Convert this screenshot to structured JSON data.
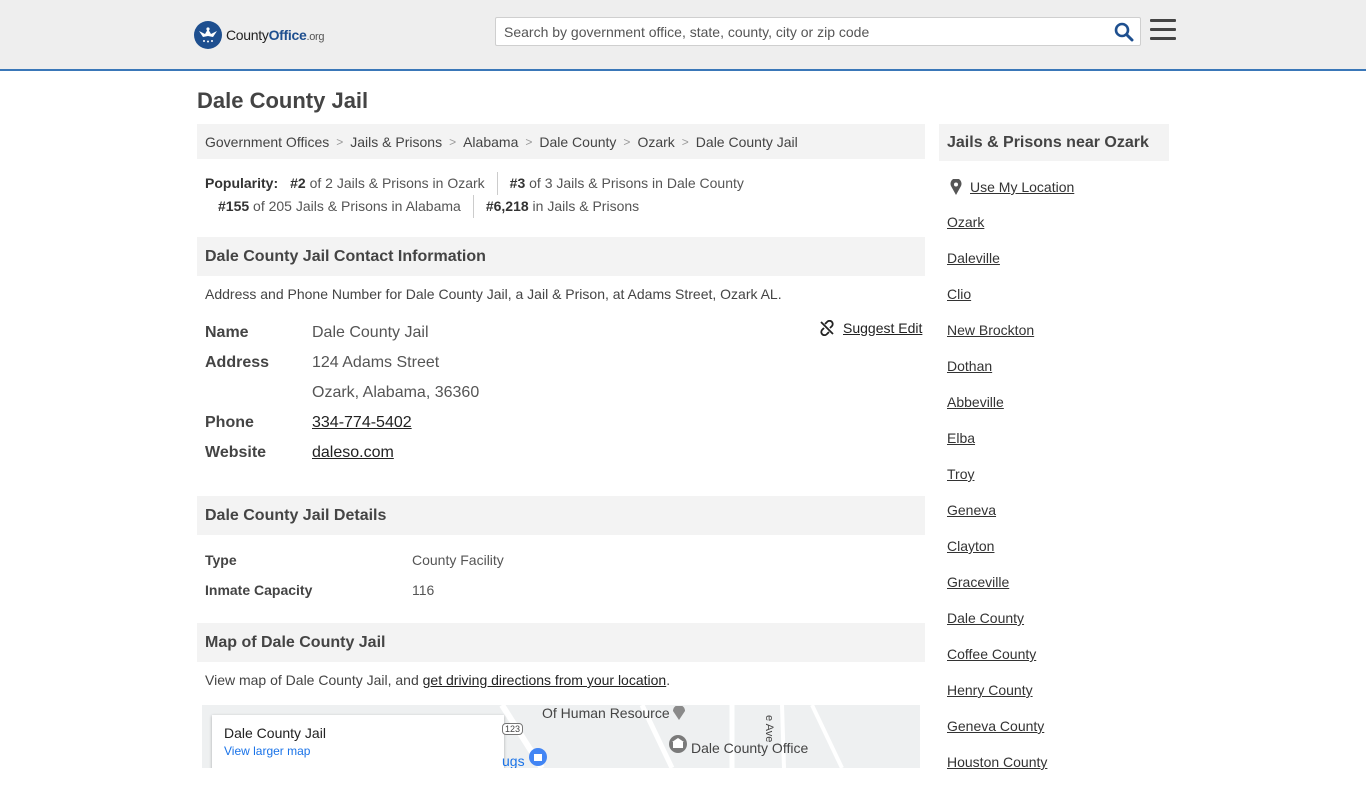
{
  "header": {
    "logo_county": "County",
    "logo_office": "Office",
    "logo_org": ".org",
    "search_placeholder": "Search by government office, state, county, city or zip code"
  },
  "page": {
    "title": "Dale County Jail"
  },
  "breadcrumb": [
    "Government Offices",
    "Jails & Prisons",
    "Alabama",
    "Dale County",
    "Ozark",
    "Dale County Jail"
  ],
  "popularity": {
    "label": "Popularity:",
    "items": [
      {
        "rank": "#2",
        "text": " of 2 Jails & Prisons in Ozark"
      },
      {
        "rank": "#3",
        "text": " of 3 Jails & Prisons in Dale County"
      },
      {
        "rank": "#155",
        "text": " of 205 Jails & Prisons in Alabama"
      },
      {
        "rank": "#6,218",
        "text": " in Jails & Prisons"
      }
    ]
  },
  "contact": {
    "heading": "Dale County Jail Contact Information",
    "description": "Address and Phone Number for Dale County Jail, a Jail & Prison, at Adams Street, Ozark AL.",
    "suggest_edit": "Suggest Edit",
    "name_label": "Name",
    "name": "Dale County Jail",
    "address_label": "Address",
    "address_line1": "124 Adams Street",
    "address_line2": "Ozark, Alabama, 36360",
    "phone_label": "Phone",
    "phone": "334-774-5402",
    "website_label": "Website",
    "website": "daleso.com"
  },
  "details": {
    "heading": "Dale County Jail Details",
    "type_label": "Type",
    "type": "County Facility",
    "capacity_label": "Inmate Capacity",
    "capacity": "116"
  },
  "map": {
    "heading": "Map of Dale County Jail",
    "desc_prefix": "View map of Dale County Jail, and ",
    "desc_link": "get driving directions from your location",
    "desc_suffix": ".",
    "card_title": "Dale County Jail",
    "card_link": "View larger map",
    "label_hr": "Of Human Resource",
    "label_office": "Dale County Office",
    "label_route": "123",
    "label_drugs": "ugs",
    "label_ave": "e Ave"
  },
  "sidebar": {
    "heading": "Jails & Prisons near Ozark",
    "use_location": "Use My Location",
    "items": [
      "Ozark",
      "Daleville",
      "Clio",
      "New Brockton",
      "Dothan",
      "Abbeville",
      "Elba",
      "Troy",
      "Geneva",
      "Clayton",
      "Graceville",
      "Dale County",
      "Coffee County",
      "Henry County",
      "Geneva County",
      "Houston County"
    ]
  },
  "colors": {
    "accent": "#3a77b8",
    "logo_blue": "#1e4f8f",
    "link_blue": "#1a73e8"
  }
}
